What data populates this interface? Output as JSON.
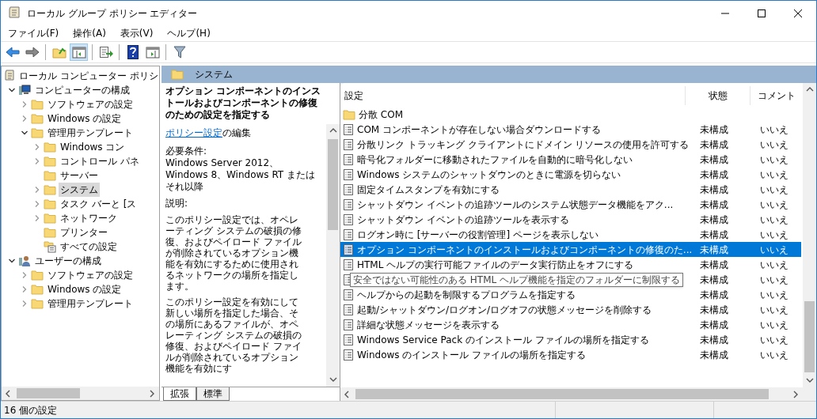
{
  "window": {
    "title": "ローカル グループ ポリシー エディター"
  },
  "menu": [
    "ファイル(F)",
    "操作(A)",
    "表示(V)",
    "ヘルプ(H)"
  ],
  "toolbar": [
    {
      "kind": "back",
      "pressed": false
    },
    {
      "kind": "forward",
      "pressed": false
    },
    {
      "kind": "sep"
    },
    {
      "kind": "up",
      "pressed": false
    },
    {
      "kind": "tree",
      "pressed": true
    },
    {
      "kind": "sep"
    },
    {
      "kind": "export",
      "pressed": false
    },
    {
      "kind": "sep"
    },
    {
      "kind": "help",
      "pressed": false
    },
    {
      "kind": "pane",
      "pressed": false
    },
    {
      "kind": "sep"
    },
    {
      "kind": "filter",
      "pressed": false
    }
  ],
  "tree": [
    {
      "label": "ローカル コンピューター ポリシ",
      "kind": "scroll",
      "selected": false,
      "children": [
        {
          "label": "コンピューターの構成",
          "kind": "computer",
          "expandable": true,
          "expanded": true,
          "selected": false,
          "children": [
            {
              "label": "ソフトウェアの設定",
              "kind": "folder",
              "expandable": true,
              "expanded": false,
              "selected": false
            },
            {
              "label": "Windows の設定",
              "kind": "folder",
              "expandable": true,
              "expanded": false,
              "selected": false
            },
            {
              "label": "管理用テンプレート",
              "kind": "folder",
              "expandable": true,
              "expanded": true,
              "selected": false,
              "children": [
                {
                  "label": "Windows コン",
                  "kind": "folder",
                  "expandable": true,
                  "expanded": false,
                  "selected": false
                },
                {
                  "label": "コントロール パネ",
                  "kind": "folder",
                  "expandable": true,
                  "expanded": false,
                  "selected": false
                },
                {
                  "label": "サーバー",
                  "kind": "folder",
                  "expandable": false,
                  "expanded": false,
                  "selected": false
                },
                {
                  "label": "システム",
                  "kind": "folder",
                  "expandable": true,
                  "expanded": false,
                  "selected": true
                },
                {
                  "label": "タスク バーと [ス",
                  "kind": "folder",
                  "expandable": true,
                  "expanded": false,
                  "selected": false
                },
                {
                  "label": "ネットワーク",
                  "kind": "folder",
                  "expandable": true,
                  "expanded": false,
                  "selected": false
                },
                {
                  "label": "プリンター",
                  "kind": "folder",
                  "expandable": false,
                  "expanded": false,
                  "selected": false
                },
                {
                  "label": "すべての設定",
                  "kind": "settings",
                  "expandable": false,
                  "expanded": false,
                  "selected": false
                }
              ]
            }
          ]
        },
        {
          "label": "ユーザーの構成",
          "kind": "user",
          "expandable": true,
          "expanded": true,
          "selected": false,
          "children": [
            {
              "label": "ソフトウェアの設定",
              "kind": "folder",
              "expandable": true,
              "expanded": false,
              "selected": false
            },
            {
              "label": "Windows の設定",
              "kind": "folder",
              "expandable": true,
              "expanded": false,
              "selected": false
            },
            {
              "label": "管理用テンプレート",
              "kind": "folder",
              "expandable": true,
              "expanded": false,
              "selected": false
            }
          ]
        }
      ]
    }
  ],
  "header": {
    "title": "システム"
  },
  "description": {
    "title": "オプション コンポーネントのインストールおよびコンポーネントの修復のための設定を指定する",
    "link": "ポリシー設定",
    "link_suffix": "の編集",
    "requirements_label": "必要条件:",
    "requirements": "Windows Server 2012、Windows 8、Windows RT またはそれ以降",
    "description_label": "説明:",
    "paragraphs": [
      "このポリシー設定では、オペレーティング システムの破損の修復、およびペイロード ファイルが削除されているオプション機能を有効にするために使用されるネットワークの場所を指定します。",
      "このポリシー設定を有効にして新しい場所を指定した場合、その場所にあるファイルが、オペレーティング システムの破損の修復、およびペイロード ファイルが削除されているオプション機能を有効にす"
    ]
  },
  "bottom_tabs": [
    {
      "label": "拡張",
      "selected": true
    },
    {
      "label": "標準",
      "selected": false
    }
  ],
  "table": {
    "columns": [
      "設定",
      "状態",
      "コメント"
    ],
    "rows": [
      {
        "kind": "folder",
        "name": "分散 COM",
        "selected": false
      },
      {
        "kind": "policy",
        "name": "COM コンポーネントが存在しない場合ダウンロードする",
        "state": "未構成",
        "comment": "いいえ",
        "selected": false
      },
      {
        "kind": "policy",
        "name": "分散リンク トラッキング クライアントにドメイン リソースの使用を許可する",
        "state": "未構成",
        "comment": "いいえ",
        "selected": false
      },
      {
        "kind": "policy",
        "name": "暗号化フォルダーに移動されたファイルを自動的に暗号化しない",
        "state": "未構成",
        "comment": "いいえ",
        "selected": false
      },
      {
        "kind": "policy",
        "name": "Windows システムのシャットダウンのときに電源を切らない",
        "state": "未構成",
        "comment": "いいえ",
        "selected": false
      },
      {
        "kind": "policy",
        "name": "固定タイムスタンプを有効にする",
        "state": "未構成",
        "comment": "いいえ",
        "selected": false
      },
      {
        "kind": "policy",
        "name": "シャットダウン イベントの追跡ツールのシステム状態データ機能をアク...",
        "state": "未構成",
        "comment": "いいえ",
        "selected": false
      },
      {
        "kind": "policy",
        "name": "シャットダウン イベントの追跡ツールを表示する",
        "state": "未構成",
        "comment": "いいえ",
        "selected": false
      },
      {
        "kind": "policy",
        "name": "ログオン時に [サーバーの役割管理] ページを表示しない",
        "state": "未構成",
        "comment": "いいえ",
        "selected": false
      },
      {
        "kind": "policy",
        "name": "オプション コンポーネントのインストールおよびコンポーネントの修復のた...",
        "state": "未構成",
        "comment": "いいえ",
        "selected": true
      },
      {
        "kind": "policy",
        "name": "HTML ヘルプの実行可能ファイルのデータ実行防止をオフにする",
        "state": "未構成",
        "comment": "いいえ",
        "selected": false
      },
      {
        "kind": "policy",
        "state": "未構成",
        "comment": "いいえ",
        "selected": false,
        "tooltip": "安全ではない可能性のある HTML ヘルプ機能を指定のフォルダーに制限する"
      },
      {
        "kind": "policy",
        "name": "ヘルプからの起動を制限するプログラムを指定する",
        "state": "未構成",
        "comment": "いいえ",
        "selected": false
      },
      {
        "kind": "policy",
        "name": "起動/シャットダウン/ログオン/ログオフの状態メッセージを削除する",
        "state": "未構成",
        "comment": "いいえ",
        "selected": false
      },
      {
        "kind": "policy",
        "name": "詳細な状態メッセージを表示する",
        "state": "未構成",
        "comment": "いいえ",
        "selected": false
      },
      {
        "kind": "policy",
        "name": "Windows Service Pack のインストール ファイルの場所を指定する",
        "state": "未構成",
        "comment": "いいえ",
        "selected": false
      },
      {
        "kind": "policy",
        "name": "Windows のインストール ファイルの場所を指定する",
        "state": "未構成",
        "comment": "いいえ",
        "selected": false
      }
    ]
  },
  "status_bar": "16 個の設定"
}
